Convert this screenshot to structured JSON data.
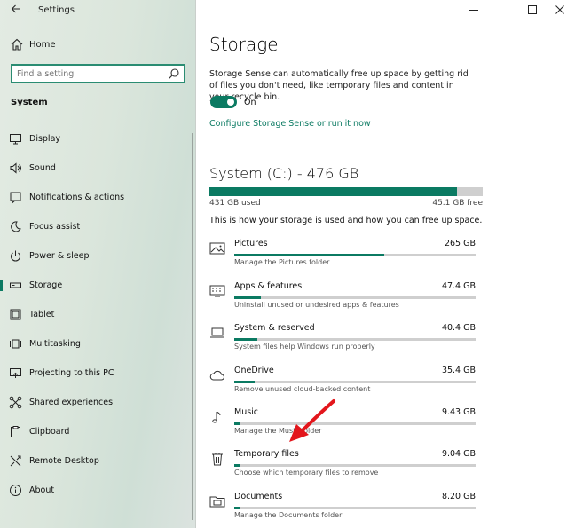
{
  "window": {
    "title": "Settings"
  },
  "sidebar": {
    "home_label": "Home",
    "search_placeholder": "Find a setting",
    "section": "System",
    "items": [
      {
        "label": "Display",
        "icon": "display-icon"
      },
      {
        "label": "Sound",
        "icon": "sound-icon"
      },
      {
        "label": "Notifications & actions",
        "icon": "notifications-icon"
      },
      {
        "label": "Focus assist",
        "icon": "moon-icon"
      },
      {
        "label": "Power & sleep",
        "icon": "power-icon"
      },
      {
        "label": "Storage",
        "icon": "storage-icon",
        "active": true
      },
      {
        "label": "Tablet",
        "icon": "tablet-icon"
      },
      {
        "label": "Multitasking",
        "icon": "multitasking-icon"
      },
      {
        "label": "Projecting to this PC",
        "icon": "projecting-icon"
      },
      {
        "label": "Shared experiences",
        "icon": "shared-icon"
      },
      {
        "label": "Clipboard",
        "icon": "clipboard-icon"
      },
      {
        "label": "Remote Desktop",
        "icon": "remote-desktop-icon"
      },
      {
        "label": "About",
        "icon": "info-icon"
      }
    ]
  },
  "main": {
    "title": "Storage",
    "description": "Storage Sense can automatically free up space by getting rid of files you don't need, like temporary files and content in your recycle bin.",
    "toggle_state": "On",
    "configure_link": "Configure Storage Sense or run it now",
    "drive": {
      "title": "System (C:) - 476 GB",
      "used_label": "431 GB used",
      "free_label": "45.1 GB free",
      "used_fraction": 0.905
    },
    "usage_description": "This is how your storage is used and how you can free up space.",
    "categories": [
      {
        "name": "Pictures",
        "size": "265 GB",
        "sub": "Manage the Pictures folder",
        "fraction": 0.62,
        "icon": "pictures-icon"
      },
      {
        "name": "Apps & features",
        "size": "47.4 GB",
        "sub": "Uninstall unused or undesired apps & features",
        "fraction": 0.11,
        "icon": "apps-icon"
      },
      {
        "name": "System & reserved",
        "size": "40.4 GB",
        "sub": "System files help Windows run properly",
        "fraction": 0.095,
        "icon": "laptop-icon"
      },
      {
        "name": "OneDrive",
        "size": "35.4 GB",
        "sub": "Remove unused cloud-backed content",
        "fraction": 0.085,
        "icon": "cloud-icon"
      },
      {
        "name": "Music",
        "size": "9.43 GB",
        "sub": "Manage the Music folder",
        "fraction": 0.025,
        "icon": "music-icon"
      },
      {
        "name": "Temporary files",
        "size": "9.04 GB",
        "sub": "Choose which temporary files to remove",
        "fraction": 0.024,
        "icon": "trash-icon"
      },
      {
        "name": "Documents",
        "size": "8.20 GB",
        "sub": "Manage the Documents folder",
        "fraction": 0.022,
        "icon": "documents-icon"
      }
    ]
  },
  "colors": {
    "accent": "#0b7a62",
    "annotation_arrow": "#e3161c"
  }
}
